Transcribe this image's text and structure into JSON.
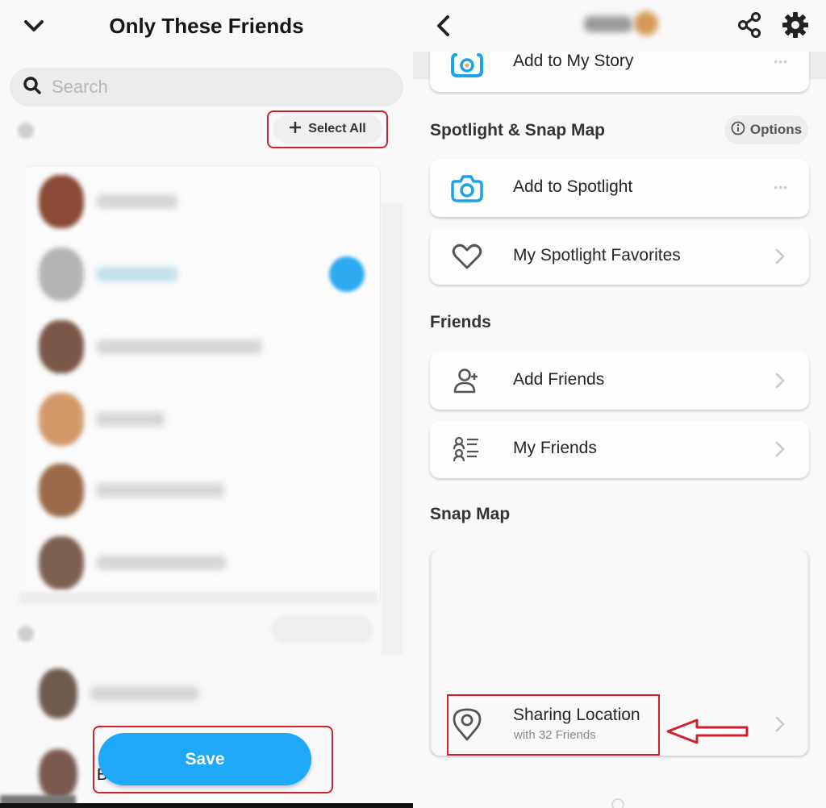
{
  "left_panel": {
    "title": "Only These Friends",
    "back_icon": "chevron-down-icon",
    "search": {
      "placeholder": "Search",
      "value": "",
      "icon": "search-icon"
    },
    "select_all_label": "Select All",
    "select_all_icon": "plus-icon",
    "friends": [
      {
        "name": "(blurred)",
        "selected": false,
        "avatar_color": "#8a4a35"
      },
      {
        "name": "(blurred)",
        "selected": true,
        "avatar_color": "#b5b5b5"
      },
      {
        "name": "(blurred)",
        "selected": false,
        "avatar_color": "#7b5848"
      },
      {
        "name": "(blurred)",
        "selected": false,
        "avatar_color": "#d29a6a"
      },
      {
        "name": "(blurred)",
        "selected": false,
        "avatar_color": "#9a6a4a"
      },
      {
        "name": "(blurred)",
        "selected": false,
        "avatar_color": "#7d6050"
      },
      {
        "name": "(blurred)",
        "selected": false,
        "avatar_color": "#6f5a50"
      },
      {
        "name": "(blurred)",
        "selected": false,
        "avatar_color": "#7b5a50"
      }
    ],
    "save_label": "Save",
    "peek_text": "B",
    "accent_color": "#1ea8f7",
    "annotation_color": "#d0202c"
  },
  "right_panel": {
    "header": {
      "back_icon": "chevron-left-icon",
      "username": "(blurred)",
      "share_icon": "share-icon",
      "settings_icon": "gear-icon"
    },
    "story_item": {
      "label": "Add to My Story",
      "icon": "story-camera-icon"
    },
    "spotlight_section": {
      "title": "Spotlight & Snap Map",
      "options_label": "Options",
      "items": [
        {
          "label": "Add to Spotlight",
          "icon": "camera-icon",
          "trailing": "more-icon"
        },
        {
          "label": "My Spotlight Favorites",
          "icon": "heart-icon",
          "trailing": "chevron-right-icon"
        }
      ]
    },
    "friends_section": {
      "title": "Friends",
      "items": [
        {
          "label": "Add Friends",
          "icon": "add-friend-icon"
        },
        {
          "label": "My Friends",
          "icon": "friends-list-icon"
        }
      ]
    },
    "snap_map_section": {
      "title": "Snap Map",
      "sharing": {
        "title": "Sharing Location",
        "subtitle": "with 32 Friends",
        "icon": "location-pin-icon"
      }
    }
  }
}
